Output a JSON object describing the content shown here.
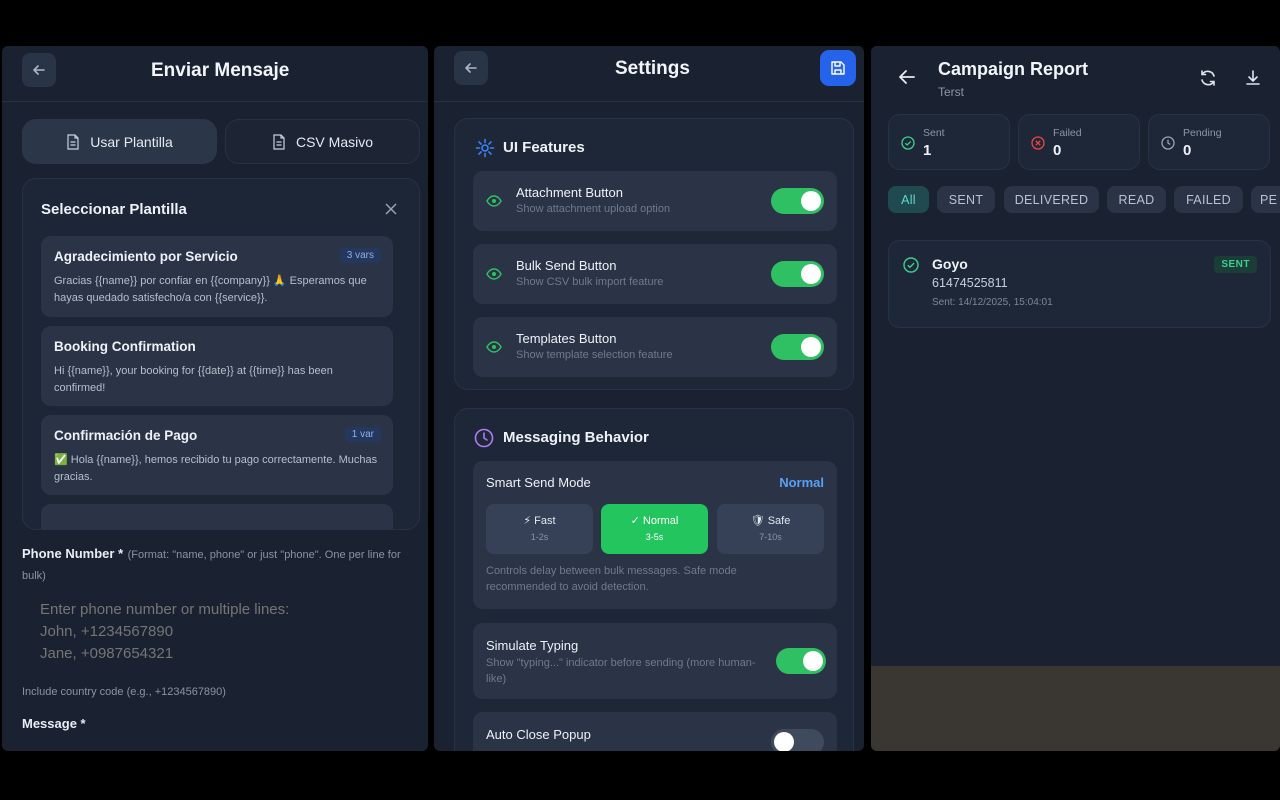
{
  "compose": {
    "title": "Enviar Mensaje",
    "tab_template": "Usar Plantilla",
    "tab_csv": "CSV Masivo",
    "modal_title": "Seleccionar Plantilla",
    "templates": [
      {
        "name": "Agradecimiento por Servicio",
        "badge": "3 vars",
        "body": "Gracias {{name}} por confiar en {{company}} 🙏 Esperamos que hayas quedado satisfecho/a con {{service}}."
      },
      {
        "name": "Booking Confirmation",
        "badge": "",
        "body": "Hi {{name}}, your booking for {{date}} at {{time}} has been confirmed!"
      },
      {
        "name": "Confirmación de Pago",
        "badge": "1 var",
        "body": "✅ Hola {{name}}, hemos recibido tu pago correctamente. Muchas gracias."
      }
    ],
    "phone_label": "Phone Number *",
    "phone_hint": "(Format: \"name, phone\" or just \"phone\". One per line for bulk)",
    "phone_placeholder": "Enter phone number or multiple lines:\nJohn, +1234567890\nJane, +0987654321",
    "phone_note": "Include country code (e.g., +1234567890)",
    "message_label": "Message *"
  },
  "settings": {
    "title": "Settings",
    "ui_section": "UI Features",
    "features": [
      {
        "name": "Attachment Button",
        "desc": "Show attachment upload option",
        "on": true
      },
      {
        "name": "Bulk Send Button",
        "desc": "Show CSV bulk import feature",
        "on": true
      },
      {
        "name": "Templates Button",
        "desc": "Show template selection feature",
        "on": true
      }
    ],
    "behavior_section": "Messaging Behavior",
    "smart_send_label": "Smart Send Mode",
    "smart_send_value": "Normal",
    "modes": [
      {
        "name": "⚡ Fast",
        "range": "1-2s"
      },
      {
        "name": "✓ Normal",
        "range": "3-5s"
      },
      {
        "name": "🛡 Safe",
        "range": "7-10s"
      }
    ],
    "mode_note": "Controls delay between bulk messages. Safe mode recommended to avoid detection.",
    "simulate_label": "Simulate Typing",
    "simulate_desc": "Show \"typing...\" indicator before sending (more human-like)",
    "simulate_on": true,
    "autoclose_label": "Auto Close Popup",
    "autoclose_on": false
  },
  "report": {
    "title": "Campaign Report",
    "subtitle": "Terst",
    "stats": [
      {
        "label": "Sent",
        "value": "1",
        "color": "#3ecf8e"
      },
      {
        "label": "Failed",
        "value": "0",
        "color": "#ef4444"
      },
      {
        "label": "Pending",
        "value": "0",
        "color": "#9aa3b2"
      }
    ],
    "filters": [
      "All",
      "SENT",
      "DELIVERED",
      "READ",
      "FAILED",
      "PE"
    ],
    "row": {
      "name": "Goyo",
      "phone": "61474525811",
      "sent_time": "Sent: 14/12/2025, 15:04:01",
      "status": "SENT"
    }
  },
  "colors": {
    "accent_green": "#22c55e",
    "accent_blue": "#2563eb",
    "link_blue": "#5aa0f2"
  }
}
